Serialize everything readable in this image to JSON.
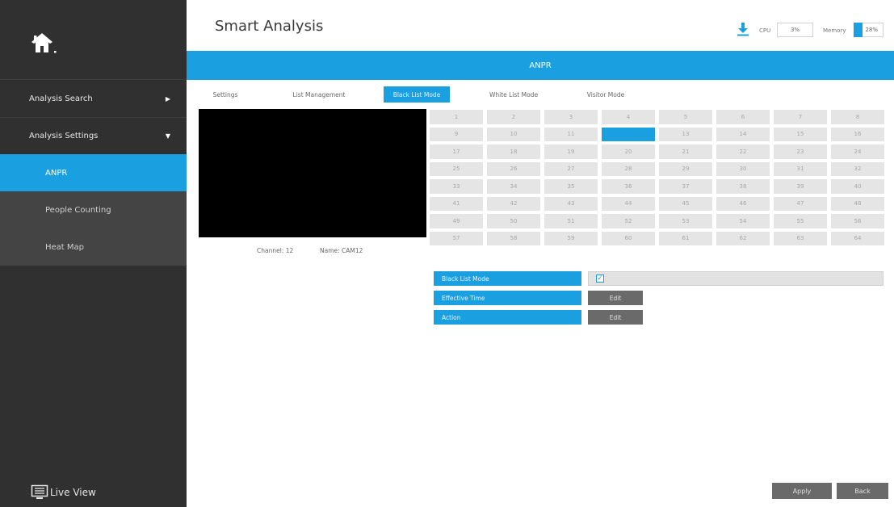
{
  "header": {
    "title": "Smart Analysis",
    "cpu_label": "CPU",
    "cpu_value": "3%",
    "memory_label": "Memory",
    "memory_value": "28%"
  },
  "sidebar": {
    "items": [
      {
        "label": "Analysis Search",
        "arrow": "▶"
      },
      {
        "label": "Analysis Settings",
        "arrow": "▼"
      },
      {
        "label": "ANPR"
      },
      {
        "label": "People Counting"
      },
      {
        "label": "Heat Map"
      }
    ],
    "live_view": "Live View"
  },
  "banner": {
    "title": "ANPR"
  },
  "tabs": [
    {
      "label": "Settings"
    },
    {
      "label": "List Management"
    },
    {
      "label": "Black List Mode"
    },
    {
      "label": "White List Mode"
    },
    {
      "label": "Visitor Mode"
    }
  ],
  "preview": {
    "channel": "Channel: 12",
    "name": "Name: CAM12"
  },
  "channels": {
    "labels": [
      "1",
      "2",
      "3",
      "4",
      "5",
      "6",
      "7",
      "8",
      "9",
      "10",
      "11",
      "12",
      "13",
      "14",
      "15",
      "16",
      "17",
      "18",
      "19",
      "20",
      "21",
      "22",
      "23",
      "24",
      "25",
      "26",
      "27",
      "28",
      "29",
      "30",
      "31",
      "32",
      "33",
      "34",
      "35",
      "36",
      "37",
      "38",
      "39",
      "40",
      "41",
      "42",
      "43",
      "44",
      "45",
      "46",
      "47",
      "48",
      "49",
      "50",
      "51",
      "52",
      "53",
      "54",
      "55",
      "56",
      "57",
      "58",
      "59",
      "60",
      "61",
      "62",
      "63",
      "64"
    ],
    "selected": "12"
  },
  "settings": {
    "black_list_mode_label": "Black List Mode",
    "black_list_mode_checked": true,
    "effective_time_label": "Effective Time",
    "action_label": "Action",
    "edit_label": "Edit"
  },
  "footer": {
    "apply": "Apply",
    "back": "Back"
  },
  "colors": {
    "accent": "#1aa0e0",
    "sidebar_bg": "#303030",
    "button_gray": "#6a6a6a"
  }
}
